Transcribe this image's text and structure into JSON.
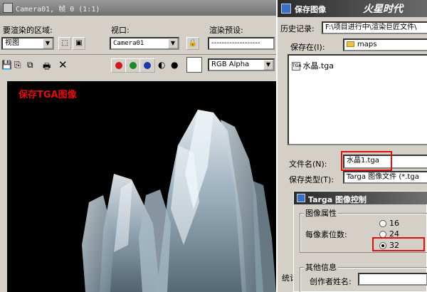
{
  "frame_window": {
    "title": "Camera01, 帧 0 (1:1)",
    "area_label": "要渲染的区域:",
    "area_value": "视图",
    "viewport_label": "视口:",
    "viewport_value": "Camera01",
    "preset_label": "渲染预设:",
    "preset_value": "-------------------",
    "channel_value": "RGB Alpha",
    "overlay_caption": "保存TGA图像",
    "stats_label": "统计"
  },
  "save_dialog": {
    "title": "保存图像",
    "watermark": "火星时代",
    "history_label": "历史记录:",
    "history_value": "F:\\项目进行中\\渲染巨匠文件\\",
    "save_in_label": "保存在(I):",
    "save_in_value": "maps",
    "files": [
      {
        "name": "水晶.tga",
        "icon": "tga-file-icon"
      }
    ],
    "filename_label": "文件名(N):",
    "filename_value": "水晶1.tga",
    "filetype_label": "保存类型(T):",
    "filetype_value": "Targa 图像文件 (*.tga"
  },
  "targa_dialog": {
    "title": "Targa 图像控制",
    "props_group": "图像属性",
    "bits_label": "每像素位数:",
    "options": [
      {
        "label": "16",
        "selected": false
      },
      {
        "label": "24",
        "selected": false
      },
      {
        "label": "32",
        "selected": true
      }
    ],
    "other_group": "其他信息",
    "author_label": "创作者姓名:"
  },
  "colors": {
    "red_channel": "#cc1a1a",
    "green_channel": "#1a8a2a",
    "blue_channel": "#1a3aaa",
    "highlight": "#e01010"
  }
}
